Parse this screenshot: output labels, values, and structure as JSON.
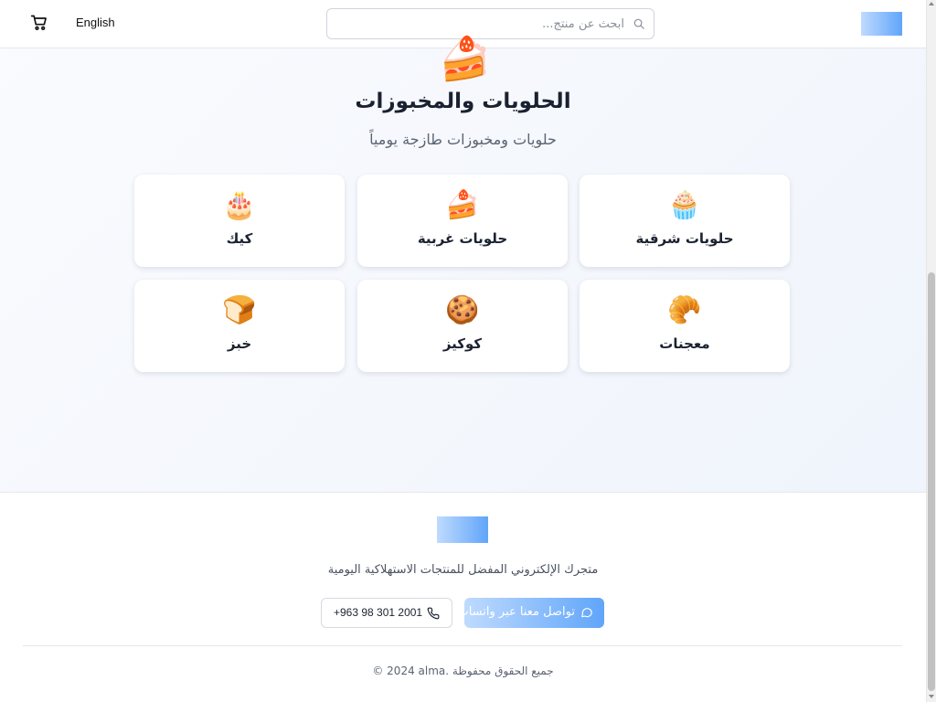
{
  "header": {
    "language_label": "English",
    "search_placeholder": "ابحث عن منتج..."
  },
  "hero": {
    "emoji": "🍰",
    "title": "الحلويات والمخبوزات",
    "subtitle": "حلويات ومخبوزات طازجة يومياً"
  },
  "categories": [
    {
      "emoji": "🧁",
      "label": "حلويات شرقية"
    },
    {
      "emoji": "🍰",
      "label": "حلويات غربية"
    },
    {
      "emoji": "🎂",
      "label": "كيك"
    },
    {
      "emoji": "🥐",
      "label": "معجنات"
    },
    {
      "emoji": "🍪",
      "label": "كوكيز"
    },
    {
      "emoji": "🍞",
      "label": "خبز"
    }
  ],
  "footer": {
    "tagline": "متجرك الإلكتروني المفضل للمنتجات الاستهلاكية اليومية",
    "whatsapp_label": "تواصل معنا عبر واتساب",
    "phone_label": "+963 98 301 2001",
    "copyright": "© 2024 alma. جميع الحقوق محفوظة"
  },
  "colors": {
    "accent_gradient_start": "#bfdbfe",
    "accent_gradient_end": "#60a5fa"
  }
}
